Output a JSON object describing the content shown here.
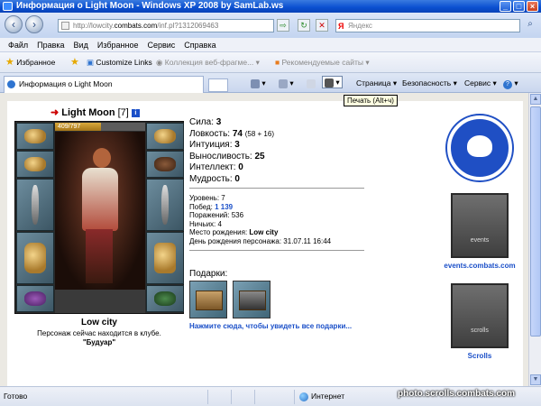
{
  "window": {
    "title": "Информация о Light Moon - Windows XP 2008 by SamLab.ws"
  },
  "address": {
    "url_prefix": "http://lowcity.",
    "url_domain": "combats.com",
    "url_suffix": "/inf.pl?1312069463"
  },
  "search": {
    "placeholder": "Яндекс",
    "brand": "Я"
  },
  "menu": [
    "Файл",
    "Правка",
    "Вид",
    "Избранное",
    "Сервис",
    "Справка"
  ],
  "favbar": {
    "favorites": "Избранное",
    "customize": "Customize Links",
    "collection": "Коллекция веб-фрагме...",
    "recommended": "Рекомендуемые сайты"
  },
  "tab": {
    "title": "Информация о Light Moon"
  },
  "toolbar": {
    "page": "Страница",
    "security": "Безопасность",
    "service": "Сервис",
    "help": "?"
  },
  "tooltip": "Печать (Alt+ч)",
  "character": {
    "name": "Light Moon",
    "level": "[7]",
    "hp": "409/797",
    "hp_fraction": 0.513,
    "emblem": "",
    "club": "Low city",
    "club_text": "Персонаж сейчас находится в клубе.",
    "location": "\"Будуар\""
  },
  "stats": [
    {
      "label": "Сила:",
      "value": "3",
      "bonus": ""
    },
    {
      "label": "Ловкость:",
      "value": "74",
      "bonus": "(58 + 16)"
    },
    {
      "label": "Интуиция:",
      "value": "3",
      "bonus": ""
    },
    {
      "label": "Выносливость:",
      "value": "25",
      "bonus": ""
    },
    {
      "label": "Интеллект:",
      "value": "0",
      "bonus": ""
    },
    {
      "label": "Мудрость:",
      "value": "0",
      "bonus": ""
    }
  ],
  "info": {
    "level_label": "Уровень:",
    "level": "7",
    "wins_label": "Побед:",
    "wins": "1 139",
    "losses_label": "Поражений:",
    "losses": "536",
    "draws_label": "Ничьих:",
    "draws": "4",
    "birthplace_label": "Место рождения:",
    "birthplace": "Low city",
    "birthday_label": "День рождения персонажа:",
    "birthday": "31.07.11 16:44"
  },
  "gifts": {
    "title": "Подарки:",
    "link": "Нажмите сюда, чтобы увидеть все подарки..."
  },
  "sidebar": {
    "banner1": "events",
    "link1": "events.combats.com",
    "banner2": "scrolls",
    "link2": "Scrolls"
  },
  "status": {
    "text": "Готово",
    "zone": "Интернет"
  },
  "watermark": "photo.scrolls.combats.com"
}
